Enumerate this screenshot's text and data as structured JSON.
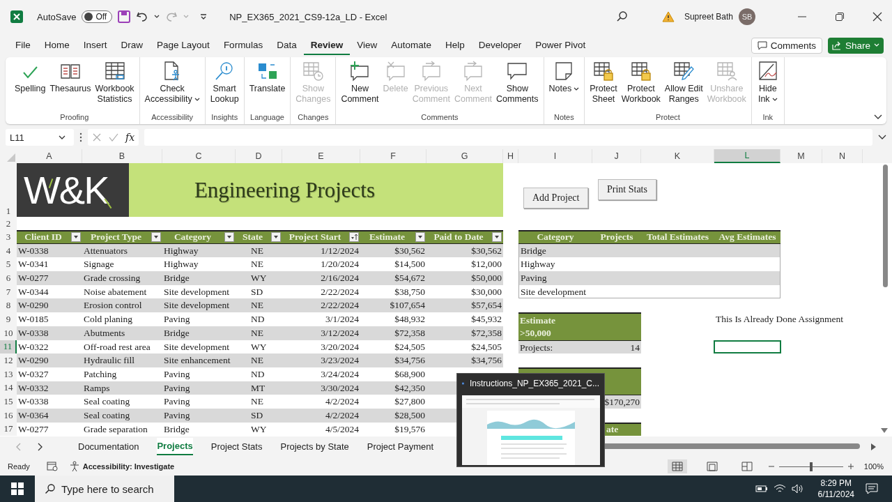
{
  "title_bar": {
    "autosave_label": "AutoSave",
    "autosave_toggle": {
      "label": "Off",
      "on": false
    },
    "title": "NP_EX365_2021_CS9-12a_LD  -  Excel",
    "user_name": "Supreet Bath",
    "user_initials": "SB"
  },
  "menu_tabs": [
    {
      "label": "File",
      "selected": false
    },
    {
      "label": "Home",
      "selected": false
    },
    {
      "label": "Insert",
      "selected": false
    },
    {
      "label": "Draw",
      "selected": false
    },
    {
      "label": "Page Layout",
      "selected": false
    },
    {
      "label": "Formulas",
      "selected": false
    },
    {
      "label": "Data",
      "selected": false
    },
    {
      "label": "Review",
      "selected": true
    },
    {
      "label": "View",
      "selected": false
    },
    {
      "label": "Automate",
      "selected": false
    },
    {
      "label": "Help",
      "selected": false
    },
    {
      "label": "Developer",
      "selected": false
    },
    {
      "label": "Power Pivot",
      "selected": false
    }
  ],
  "comments_button": "Comments",
  "share_button": "Share",
  "ribbon": {
    "groups": [
      {
        "name": "Proofing",
        "buttons": [
          {
            "lines": [
              "Spelling"
            ],
            "disabled": false,
            "dropdown": false
          },
          {
            "lines": [
              "Thesaurus"
            ],
            "disabled": false,
            "dropdown": false
          },
          {
            "lines": [
              "Workbook",
              "Statistics"
            ],
            "disabled": false,
            "dropdown": false
          }
        ]
      },
      {
        "name": "Accessibility",
        "buttons": [
          {
            "lines": [
              "Check",
              "Accessibility"
            ],
            "disabled": false,
            "dropdown": true
          }
        ]
      },
      {
        "name": "Insights",
        "buttons": [
          {
            "lines": [
              "Smart",
              "Lookup"
            ],
            "disabled": false,
            "dropdown": false
          }
        ]
      },
      {
        "name": "Language",
        "buttons": [
          {
            "lines": [
              "Translate"
            ],
            "disabled": false,
            "dropdown": false
          }
        ]
      },
      {
        "name": "Changes",
        "buttons": [
          {
            "lines": [
              "Show",
              "Changes"
            ],
            "disabled": true,
            "dropdown": false
          }
        ]
      },
      {
        "name": "Comments",
        "buttons": [
          {
            "lines": [
              "New",
              "Comment"
            ],
            "disabled": false,
            "dropdown": false
          },
          {
            "lines": [
              "Delete"
            ],
            "disabled": true,
            "dropdown": false
          },
          {
            "lines": [
              "Previous",
              "Comment"
            ],
            "disabled": true,
            "dropdown": false
          },
          {
            "lines": [
              "Next",
              "Comment"
            ],
            "disabled": true,
            "dropdown": false
          },
          {
            "lines": [
              "Show",
              "Comments"
            ],
            "disabled": false,
            "dropdown": false
          }
        ]
      },
      {
        "name": "Notes",
        "buttons": [
          {
            "lines": [
              "Notes"
            ],
            "disabled": false,
            "dropdown": true
          }
        ]
      },
      {
        "name": "Protect",
        "buttons": [
          {
            "lines": [
              "Protect",
              "Sheet"
            ],
            "disabled": false,
            "dropdown": false
          },
          {
            "lines": [
              "Protect",
              "Workbook"
            ],
            "disabled": false,
            "dropdown": false
          },
          {
            "lines": [
              "Allow Edit",
              "Ranges"
            ],
            "disabled": false,
            "dropdown": false
          },
          {
            "lines": [
              "Unshare",
              "Workbook"
            ],
            "disabled": true,
            "dropdown": false
          }
        ]
      },
      {
        "name": "Ink",
        "buttons": [
          {
            "lines": [
              "Hide",
              "Ink"
            ],
            "disabled": false,
            "dropdown": true
          }
        ]
      }
    ]
  },
  "formula_bar": {
    "name_box": "L11",
    "function_label": "fx"
  },
  "sheet": {
    "column_letters": [
      {
        "label": "A",
        "selected": false
      },
      {
        "label": "B",
        "selected": false
      },
      {
        "label": "C",
        "selected": false
      },
      {
        "label": "D",
        "selected": false
      },
      {
        "label": "E",
        "selected": false
      },
      {
        "label": "F",
        "selected": false
      },
      {
        "label": "G",
        "selected": false
      },
      {
        "label": "H",
        "selected": false
      },
      {
        "label": "I",
        "selected": false
      },
      {
        "label": "J",
        "selected": false
      },
      {
        "label": "K",
        "selected": false
      },
      {
        "label": "L",
        "selected": true
      },
      {
        "label": "M",
        "selected": false
      },
      {
        "label": "N",
        "selected": false
      }
    ],
    "row_numbers": [
      {
        "label": "1",
        "selected": false
      },
      {
        "label": "2",
        "selected": false
      },
      {
        "label": "3",
        "selected": false
      },
      {
        "label": "4",
        "selected": false
      },
      {
        "label": "5",
        "selected": false
      },
      {
        "label": "6",
        "selected": false
      },
      {
        "label": "7",
        "selected": false
      },
      {
        "label": "8",
        "selected": false
      },
      {
        "label": "9",
        "selected": false
      },
      {
        "label": "10",
        "selected": false
      },
      {
        "label": "11",
        "selected": true
      },
      {
        "label": "12",
        "selected": false
      },
      {
        "label": "13",
        "selected": false
      },
      {
        "label": "14",
        "selected": false
      },
      {
        "label": "15",
        "selected": false
      },
      {
        "label": "16",
        "selected": false
      },
      {
        "label": "17",
        "selected": false
      }
    ],
    "logo": "W&K",
    "title": "Engineering Projects",
    "buttons": [
      "Add Project",
      "Print Stats"
    ],
    "table": {
      "columns": [
        {
          "label": "Client ID",
          "sorted": false
        },
        {
          "label": "Project Type",
          "sorted": false
        },
        {
          "label": "Category",
          "sorted": false
        },
        {
          "label": "State",
          "sorted": false
        },
        {
          "label": "Project Start",
          "sorted": true
        },
        {
          "label": "Estimate",
          "sorted": false
        },
        {
          "label": "Paid to Date",
          "sorted": false
        }
      ],
      "rows": [
        [
          "W-0338",
          "Attenuators",
          "Highway",
          "NE",
          "1/12/2024",
          "$30,562",
          "$30,562"
        ],
        [
          "W-0341",
          "Signage",
          "Highway",
          "NE",
          "1/20/2024",
          "$14,500",
          "$12,000"
        ],
        [
          "W-0277",
          "Grade crossing",
          "Bridge",
          "WY",
          "2/16/2024",
          "$54,672",
          "$50,000"
        ],
        [
          "W-0344",
          "Noise abatement",
          "Site development",
          "SD",
          "2/22/2024",
          "$38,750",
          "$30,000"
        ],
        [
          "W-0290",
          "Erosion control",
          "Site development",
          "NE",
          "2/22/2024",
          "$107,654",
          "$57,654"
        ],
        [
          "W-0185",
          "Cold planing",
          "Paving",
          "ND",
          "3/1/2024",
          "$48,932",
          "$45,932"
        ],
        [
          "W-0338",
          "Abutments",
          "Bridge",
          "NE",
          "3/12/2024",
          "$72,358",
          "$72,358"
        ],
        [
          "W-0322",
          "Off-road rest area",
          "Site development",
          "WY",
          "3/20/2024",
          "$24,505",
          "$24,505"
        ],
        [
          "W-0290",
          "Hydraulic fill",
          "Site enhancement",
          "NE",
          "3/23/2024",
          "$34,756",
          "$34,756"
        ],
        [
          "W-0327",
          "Patching",
          "Paving",
          "ND",
          "3/24/2024",
          "$68,900"
        ],
        [
          "W-0332",
          "Ramps",
          "Paving",
          "MT",
          "3/30/2024",
          "$42,350"
        ],
        [
          "W-0338",
          "Seal coating",
          "Paving",
          "NE",
          "4/2/2024",
          "$27,800"
        ],
        [
          "W-0364",
          "Seal coating",
          "Paving",
          "SD",
          "4/2/2024",
          "$28,500"
        ],
        [
          "W-0277",
          "Grade separation",
          "Bridge",
          "WY",
          "4/5/2024",
          "$19,576"
        ]
      ]
    },
    "stats_table": {
      "columns": [
        "Category",
        "Projects",
        "Total Estimates",
        "Avg Estimates"
      ],
      "rows": [
        "Bridge",
        "Highway",
        "Paving",
        "Site development"
      ]
    },
    "estimate_box": {
      "header_lines": [
        "Estimate",
        ">50,000"
      ],
      "label": "Projects:",
      "value": "14"
    },
    "client_box": {
      "value": "$170,270"
    },
    "third_box": {
      "header_fragment": "ate"
    },
    "note": "This Is Already Done Assignment"
  },
  "sheet_tabs": [
    {
      "label": "Documentation",
      "selected": false
    },
    {
      "label": "Projects",
      "selected": true
    },
    {
      "label": "Project Stats",
      "selected": false
    },
    {
      "label": "Projects by State",
      "selected": false
    },
    {
      "label": "Project Payment",
      "selected": false
    }
  ],
  "status_bar": {
    "ready": "Ready",
    "accessibility": "Accessibility: Investigate",
    "zoom": "100%",
    "zoom_slider": {
      "level": 0.5
    }
  },
  "preview_popup": {
    "title": "Instructions_NP_EX365_2021_C..."
  },
  "taskbar": {
    "search_placeholder": "Type here to search",
    "time": "8:29 PM",
    "date": "6/11/2024"
  }
}
